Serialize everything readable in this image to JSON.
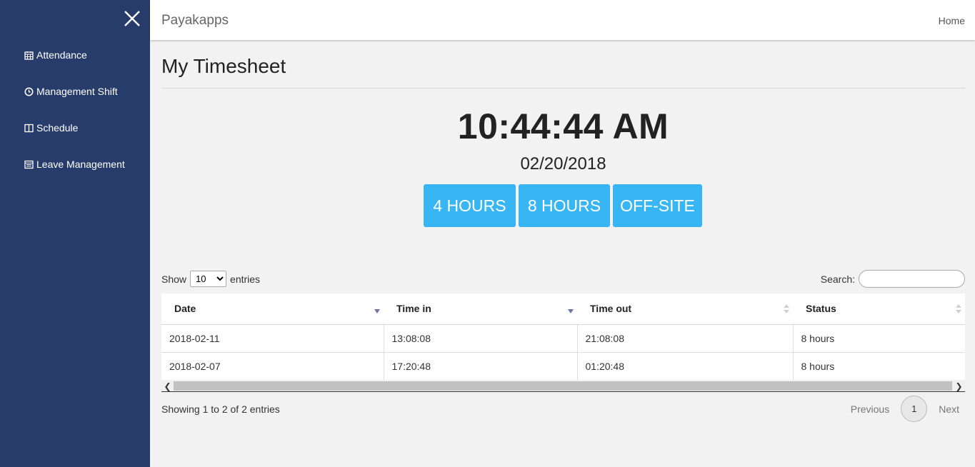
{
  "sidebar": {
    "close_icon": "close-icon",
    "items": [
      {
        "label": "Attendance",
        "icon": "calendar-icon"
      },
      {
        "label": "Management Shift",
        "icon": "clock-icon"
      },
      {
        "label": "Schedule",
        "icon": "columns-icon"
      },
      {
        "label": "Leave Management",
        "icon": "calendar-list-icon"
      }
    ]
  },
  "header": {
    "brand": "Payakapps",
    "home": "Home"
  },
  "page": {
    "title": "My Timesheet",
    "clock": "10:44:44 AM",
    "date": "02/20/2018",
    "buttons": [
      "4 HOURS",
      "8 HOURS",
      "OFF-SITE"
    ]
  },
  "table": {
    "length_prefix": "Show",
    "length_value": "10",
    "length_suffix": "entries",
    "search_label": "Search:",
    "columns": [
      "Date",
      "Time in",
      "Time out",
      "Status"
    ],
    "rows": [
      [
        "2018-02-11",
        "13:08:08",
        "21:08:08",
        "8 hours"
      ],
      [
        "2018-02-07",
        "17:20:48",
        "01:20:48",
        "8 hours"
      ]
    ],
    "info": "Showing 1 to 2 of 2 entries",
    "pager": {
      "previous": "Previous",
      "page": "1",
      "next": "Next"
    }
  },
  "colors": {
    "sidebar": "#273c6a",
    "accent": "#38b6f3",
    "background": "#f2f2f2"
  }
}
